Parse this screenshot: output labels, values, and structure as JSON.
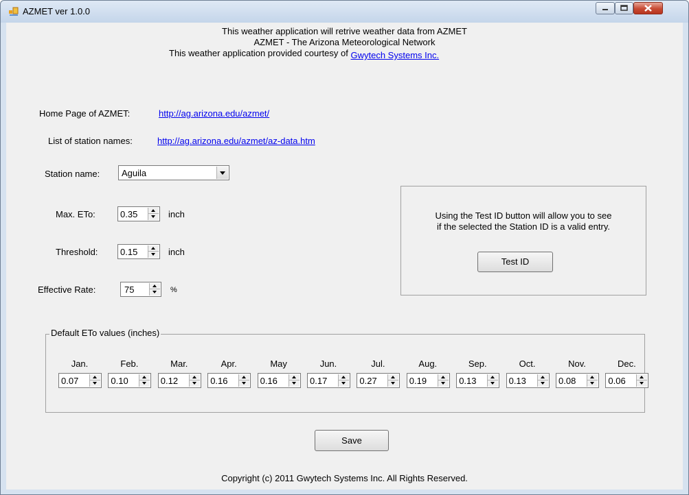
{
  "window": {
    "title": "AZMET ver 1.0.0"
  },
  "intro": {
    "line1": "This weather application will retrive weather data from AZMET",
    "line2": "AZMET - The Arizona Meteorological Network",
    "line3": "This weather application provided courtesy of",
    "courtesy_link": "Gwytech Systems Inc."
  },
  "links": {
    "home_label": "Home Page of AZMET:",
    "home_url": "http://ag.arizona.edu/azmet/",
    "stations_label": "List of station names:",
    "stations_url": "http://ag.arizona.edu/azmet/az-data.htm"
  },
  "form": {
    "station_label": "Station name:",
    "station_value": "Aguila",
    "max_eto_label": "Max. ETo:",
    "max_eto_value": "0.35",
    "max_eto_unit": "inch",
    "threshold_label": "Threshold:",
    "threshold_value": "0.15",
    "threshold_unit": "inch",
    "rate_label": "Effective Rate:",
    "rate_value": "75",
    "rate_unit": "%"
  },
  "test_panel": {
    "line1": "Using the Test ID button will allow you to see",
    "line2": "if the selected the Station ID is a valid entry.",
    "button": "Test ID"
  },
  "eto_defaults": {
    "title": "Default ETo values (inches)",
    "months": [
      {
        "label": "Jan.",
        "value": "0.07"
      },
      {
        "label": "Feb.",
        "value": "0.10"
      },
      {
        "label": "Mar.",
        "value": "0.12"
      },
      {
        "label": "Apr.",
        "value": "0.16"
      },
      {
        "label": "May",
        "value": "0.16"
      },
      {
        "label": "Jun.",
        "value": "0.17"
      },
      {
        "label": "Jul.",
        "value": "0.27"
      },
      {
        "label": "Aug.",
        "value": "0.19"
      },
      {
        "label": "Sep.",
        "value": "0.13"
      },
      {
        "label": "Oct.",
        "value": "0.13"
      },
      {
        "label": "Nov.",
        "value": "0.08"
      },
      {
        "label": "Dec.",
        "value": "0.06"
      }
    ]
  },
  "actions": {
    "save": "Save"
  },
  "footer": {
    "copyright": "Copyright (c) 2011 Gwytech Systems Inc. All Rights Reserved."
  }
}
